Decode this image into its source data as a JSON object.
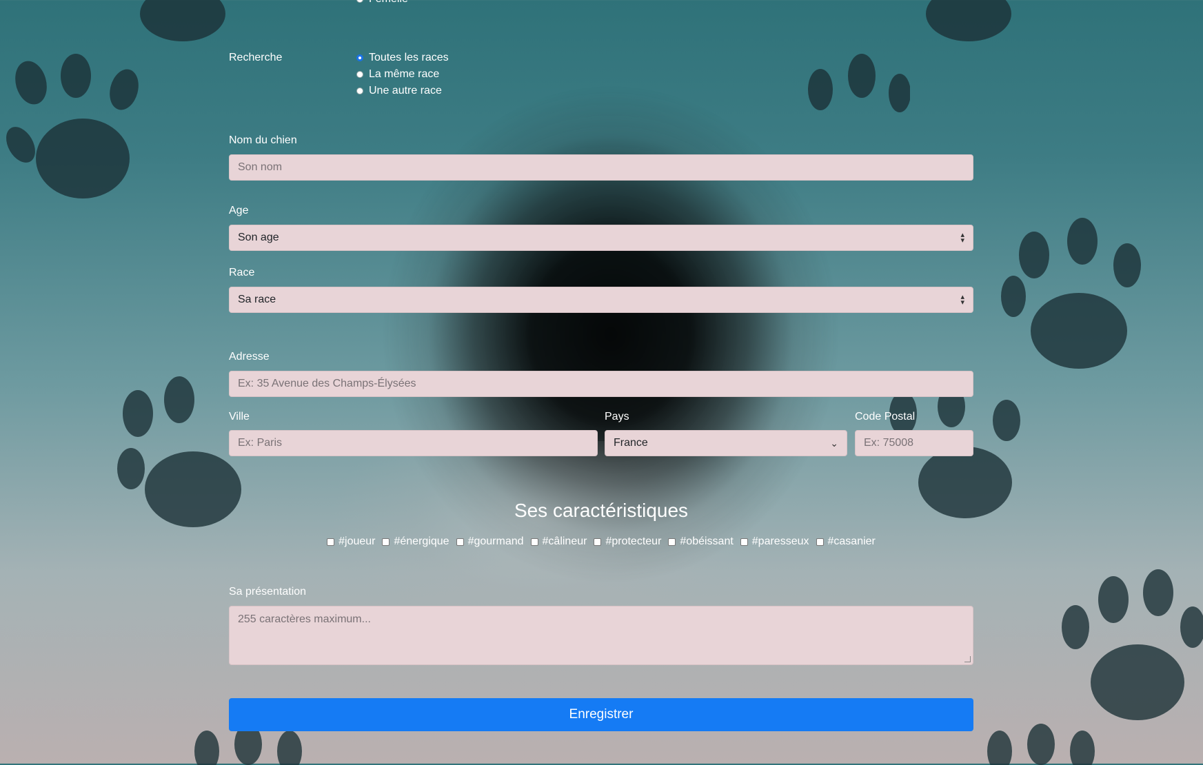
{
  "search": {
    "label": "Recherche",
    "partial_option": "Femelle",
    "options": [
      "Toutes les races",
      "La même race",
      "Une autre race"
    ],
    "selected": "Toutes les races"
  },
  "dog_name": {
    "label": "Nom du chien",
    "placeholder": "Son nom"
  },
  "age": {
    "label": "Age",
    "value": "Son age"
  },
  "breed": {
    "label": "Race",
    "value": "Sa race"
  },
  "address": {
    "label": "Adresse",
    "placeholder": "Ex: 35 Avenue des Champs-Élysées"
  },
  "city": {
    "label": "Ville",
    "placeholder": "Ex: Paris"
  },
  "country": {
    "label": "Pays",
    "value": "France"
  },
  "postal": {
    "label": "Code Postal",
    "placeholder": "Ex: 75008"
  },
  "traits": {
    "title": "Ses caractéristiques",
    "items": [
      "#joueur",
      "#énergique",
      "#gourmand",
      "#câlineur",
      "#protecteur",
      "#obéissant",
      "#paresseux",
      "#casanier"
    ]
  },
  "presentation": {
    "label": "Sa présentation",
    "placeholder": "255 caractères maximum..."
  },
  "submit": {
    "label": "Enregistrer"
  },
  "colors": {
    "field_bg": "#e8d4d7",
    "button": "#157bf4"
  }
}
